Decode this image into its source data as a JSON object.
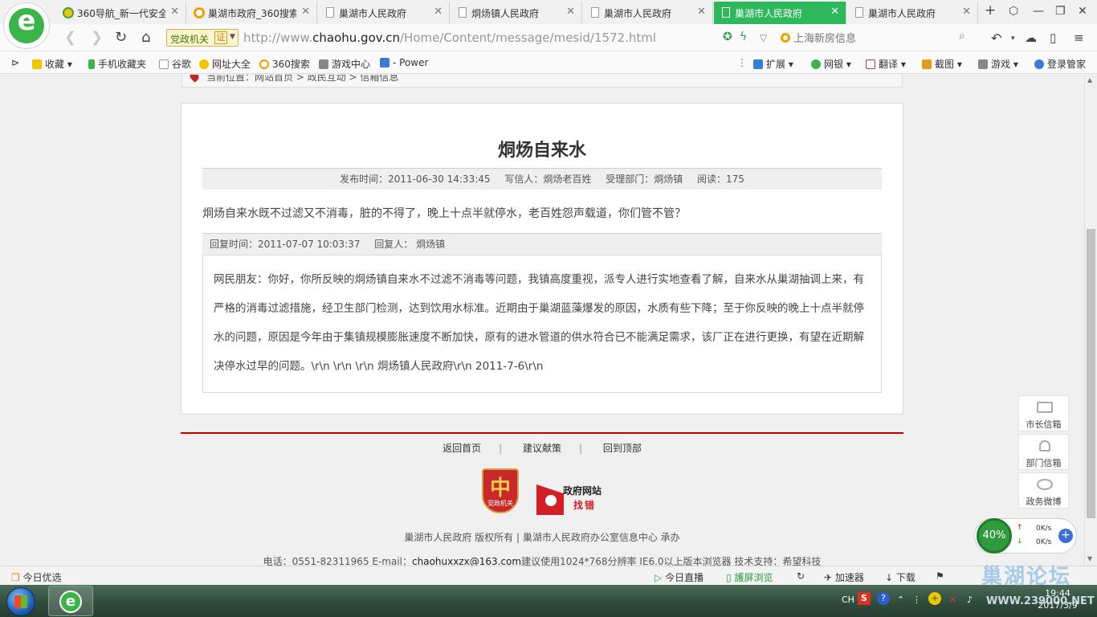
{
  "tabs": [
    {
      "label": "360导航_新一代安全",
      "icon": "360-nav-icon",
      "active": false
    },
    {
      "label": "巢湖市政府_360搜索",
      "icon": "360-search-icon",
      "active": false
    },
    {
      "label": "巢湖市人民政府",
      "icon": "page-icon",
      "active": false
    },
    {
      "label": "烔炀镇人民政府",
      "icon": "page-icon",
      "active": false
    },
    {
      "label": "巢湖市人民政府",
      "icon": "page-icon",
      "active": false
    },
    {
      "label": "巢湖市人民政府",
      "icon": "page-icon",
      "active": true
    },
    {
      "label": "巢湖市人民政府",
      "icon": "page-icon",
      "active": false
    }
  ],
  "addressbar": {
    "badge": "党政机关",
    "badge_cert": "证",
    "url_prefix": "http://www.",
    "url_domain": "chaohu.gov.cn",
    "url_path": "/Home/Content/message/mesid/1572.html",
    "search_placeholder": "上海新房信息"
  },
  "bookmarks": [
    "收藏",
    "手机收藏夹",
    "谷歌",
    "网址大全",
    "360搜索",
    "游戏中心",
    "- Power"
  ],
  "bookmarks_right": [
    "扩展",
    "网银",
    "翻译",
    "截图",
    "游戏",
    "登录管家"
  ],
  "location": {
    "label": "当前位置：",
    "path": [
      "网站首页",
      "政民互动",
      "信箱信息"
    ]
  },
  "article": {
    "title": "烔炀自来水",
    "meta": {
      "time": "发布时间：2011-06-30 14:33:45",
      "writer": "写信人：烔炀老百姓",
      "dept": "受理部门：烔炀镇",
      "reads": "阅读：175"
    },
    "question": "烔炀自来水既不过滤又不消毒，脏的不得了，晚上十点半就停水，老百姓怨声载道，你们管不管？",
    "reply_time": "回复时间：2011-07-07 10:03:37",
    "reply_person": "回复人： 烔炀镇",
    "reply_body": "网民朋友：你好，你所反映的烔炀镇自来水不过滤不消毒等问题，我镇高度重视，派专人进行实地查看了解，自来水从巢湖抽调上来，有严格的消毒过滤措施，经卫生部门检测，达到饮用水标准。近期由于巢湖蓝藻爆发的原因，水质有些下降；至于你反映的晚上十点半就停水的问题，原因是今年由于集镇规模膨胀速度不断加快，原有的进水管道的供水符合已不能满足需求，该厂正在进行更换，有望在近期解决停水过早的问题。\\r\\n \\r\\n \\r\\n 烔炀镇人民政府\\r\\n 2011-7-6\\r\\n"
  },
  "footer": {
    "links": [
      "返回首页",
      "建议献策",
      "回到顶部"
    ],
    "badge1_char": "中",
    "badge1_label": "党政机关",
    "badge2_line1": "政府网站",
    "badge2_line2": "找错",
    "copyright": "巢湖市人民政府 版权所有 | 巢湖市人民政府办公室信息中心 承办",
    "contact_prefix": "电话：0551-82311965  E-mail：",
    "contact_email": "chaohuxxzx@163.com",
    "contact_suffix": "建议使用1024*768分辨率 IE6.0以上版本浏览器 技术支持：希望科技"
  },
  "side_panel": [
    {
      "label": "市长信箱",
      "icon": "mail-icon"
    },
    {
      "label": "部门信箱",
      "icon": "dept-mail-icon"
    },
    {
      "label": "政务微博",
      "icon": "weibo-icon"
    }
  ],
  "net_widget": {
    "percent": "40%",
    "up": "0K/s",
    "down": "0K/s"
  },
  "statusbar": {
    "left": "今日优选",
    "items": [
      "今日直播",
      "護屏浏览",
      "加速器",
      "下载"
    ]
  },
  "taskbar": {
    "lang": "CH",
    "time": "19:44",
    "date": "2017/3/9"
  },
  "watermark": {
    "text": "巢湖论坛",
    "url": "WWW.239000.NET"
  }
}
